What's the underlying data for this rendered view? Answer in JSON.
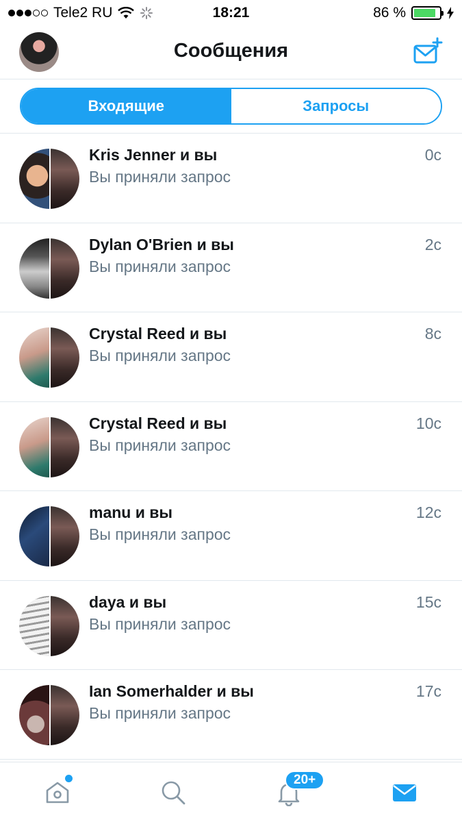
{
  "status_bar": {
    "carrier": "Tele2 RU",
    "time": "18:21",
    "battery_percent_text": "86 %",
    "battery_level": 0.86,
    "signal_bars_filled": 3,
    "signal_bars_total": 5
  },
  "header": {
    "title": "Сообщения",
    "compose_icon": "compose-message-icon"
  },
  "segmented": {
    "tabs": [
      {
        "label": "Входящие",
        "active": true
      },
      {
        "label": "Запросы",
        "active": false
      }
    ]
  },
  "conversations": [
    {
      "name": "Kris Jenner и вы",
      "preview": "Вы приняли запрос",
      "time": "0с"
    },
    {
      "name": "Dylan O'Brien и вы",
      "preview": "Вы приняли запрос",
      "time": "2с"
    },
    {
      "name": "Crystal Reed и вы",
      "preview": "Вы приняли запрос",
      "time": "8с"
    },
    {
      "name": "Crystal Reed и вы",
      "preview": "Вы приняли запрос",
      "time": "10с"
    },
    {
      "name": "manu и вы",
      "preview": "Вы приняли запрос",
      "time": "12с"
    },
    {
      "name": "daya и вы",
      "preview": "Вы приняли запрос",
      "time": "15с"
    },
    {
      "name": "Ian Somerhalder и вы",
      "preview": "Вы приняли запрос",
      "time": "17с"
    }
  ],
  "tabbar": {
    "items": [
      "home-icon",
      "search-icon",
      "notifications-icon",
      "messages-icon"
    ],
    "notifications_badge": "20+",
    "accent_color": "#1da1f2"
  },
  "colors": {
    "accent": "#1da1f2",
    "secondary_text": "#657786",
    "primary_text": "#14171a",
    "battery_fill": "#4cd964"
  }
}
